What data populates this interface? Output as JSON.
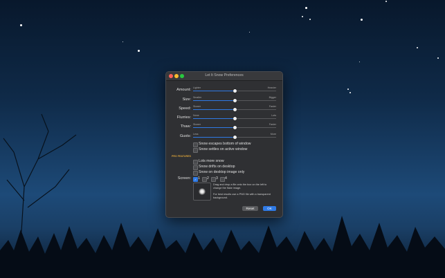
{
  "window": {
    "title": "Let It Snow Preferences"
  },
  "sliders": [
    {
      "label": "Amount:",
      "low": "Lighter",
      "high": "Heavier",
      "value": 0.5
    },
    {
      "label": "Size:",
      "low": "Smaller",
      "high": "Bigger",
      "value": 0.5
    },
    {
      "label": "Speed:",
      "low": "Slower",
      "high": "Faster",
      "value": 0.5
    },
    {
      "label": "Flurries:",
      "low": "None",
      "high": "Lots",
      "value": 0.5
    },
    {
      "label": "Thaw:",
      "low": "Slower",
      "high": "Faster",
      "value": 0.5
    },
    {
      "label": "Gusts:",
      "low": "Less",
      "high": "More",
      "value": 0.5
    }
  ],
  "options": {
    "escapes_bottom": {
      "label": "Snow escapes bottom of window",
      "checked": false
    },
    "settles_active": {
      "label": "Snow settles on active window",
      "checked": false
    }
  },
  "pro": {
    "heading": "PRO FEATURES",
    "lots_more": {
      "label": "Lots more snow",
      "checked": false
    },
    "drifts": {
      "label": "Snow drifts on desktop",
      "checked": false
    },
    "desktop_only": {
      "label": "Snow on desktop image only",
      "checked": false
    },
    "screen_label": "Screen:",
    "screens": [
      {
        "label": "1",
        "checked": true
      },
      {
        "label": "2",
        "checked": false
      },
      {
        "label": "3",
        "checked": false
      },
      {
        "label": "4",
        "checked": false
      }
    ],
    "drop_note": "Drag and drop a file onto the box on the left to change the flake image.",
    "png_note": "For best results use a PNG file with a transparent background."
  },
  "buttons": {
    "reset": "Reset",
    "ok": "OK"
  },
  "colors": {
    "accent": "#2f7ae5",
    "window_bg": "#2f3033",
    "pro_heading": "#d9a23a"
  }
}
